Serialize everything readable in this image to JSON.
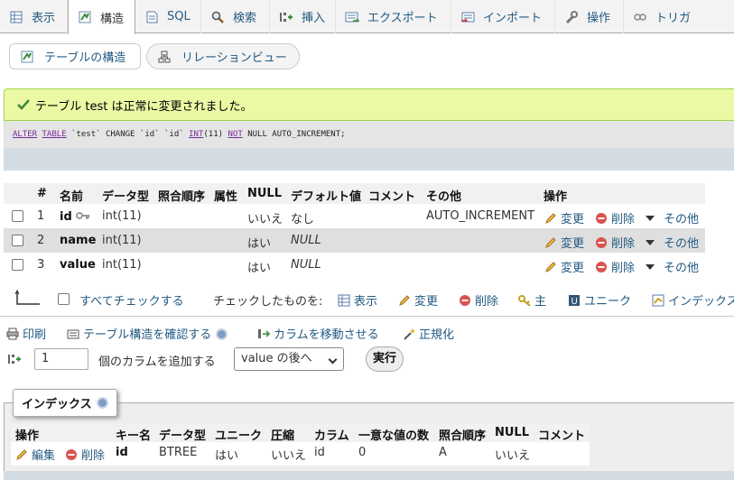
{
  "tabs": [
    {
      "label": "表示",
      "icon": "browse-icon"
    },
    {
      "label": "構造",
      "icon": "structure-icon",
      "active": true
    },
    {
      "label": "SQL",
      "icon": "sql-icon"
    },
    {
      "label": "検索",
      "icon": "search-icon"
    },
    {
      "label": "挿入",
      "icon": "insert-icon"
    },
    {
      "label": "エクスポート",
      "icon": "export-icon"
    },
    {
      "label": "インポート",
      "icon": "import-icon"
    },
    {
      "label": "操作",
      "icon": "wrench-icon"
    },
    {
      "label": "トリガ",
      "icon": "trigger-icon"
    }
  ],
  "subtabs": {
    "structure": "テーブルの構造",
    "relation": "リレーションビュー"
  },
  "success_message": "テーブル test は正常に変更されました。",
  "sql": {
    "kw1": "ALTER",
    "kw2": "TABLE",
    "t1": "`test`",
    "kw3": "CHANGE",
    "t2": "`id`",
    "t3": "`id`",
    "kw4": "INT",
    "t4": "(11)",
    "kw5": "NOT",
    "t5": "NULL AUTO_INCREMENT;"
  },
  "columns_header": [
    "#",
    "名前",
    "データ型",
    "照合順序",
    "属性",
    "NULL",
    "デフォルト値",
    "コメント",
    "その他",
    "操作"
  ],
  "rows": [
    {
      "num": "1",
      "name": "id",
      "type": "int(11)",
      "null": "いいえ",
      "default": "なし",
      "extra": "AUTO_INCREMENT"
    },
    {
      "num": "2",
      "name": "name",
      "type": "int(11)",
      "null": "はい",
      "default": "NULL",
      "extra": ""
    },
    {
      "num": "3",
      "name": "value",
      "type": "int(11)",
      "null": "はい",
      "default": "NULL",
      "extra": ""
    }
  ],
  "row_actions": {
    "change": "変更",
    "drop": "削除",
    "more": "その他"
  },
  "bulk": {
    "check_all": "すべてチェックする",
    "with_selected": "チェックしたものを:",
    "browse": "表示",
    "change": "変更",
    "drop": "削除",
    "primary": "主",
    "unique": "ユニーク",
    "index": "インデックス"
  },
  "tools": {
    "print": "印刷",
    "propose": "テーブル構造を確認する",
    "move": "カラムを移動させる",
    "normalize": "正規化"
  },
  "add_column": {
    "count": "1",
    "label": "個のカラムを追加する",
    "position": "value の後へ",
    "go": "実行"
  },
  "indexes": {
    "legend": "インデックス",
    "header": [
      "操作",
      "キー名",
      "データ型",
      "ユニーク",
      "圧縮",
      "カラム",
      "一意な値の数",
      "照合順序",
      "NULL",
      "コメント"
    ],
    "row": {
      "edit": "編集",
      "drop": "削除",
      "key": "id",
      "type": "BTREE",
      "unique": "はい",
      "packed": "いいえ",
      "column": "id",
      "cardinality": "0",
      "collation": "A",
      "null": "いいえ",
      "comment": ""
    }
  },
  "colors": {
    "link": "#235a81",
    "success_bg": "#ebf8a4",
    "drop": "#d9534f"
  }
}
